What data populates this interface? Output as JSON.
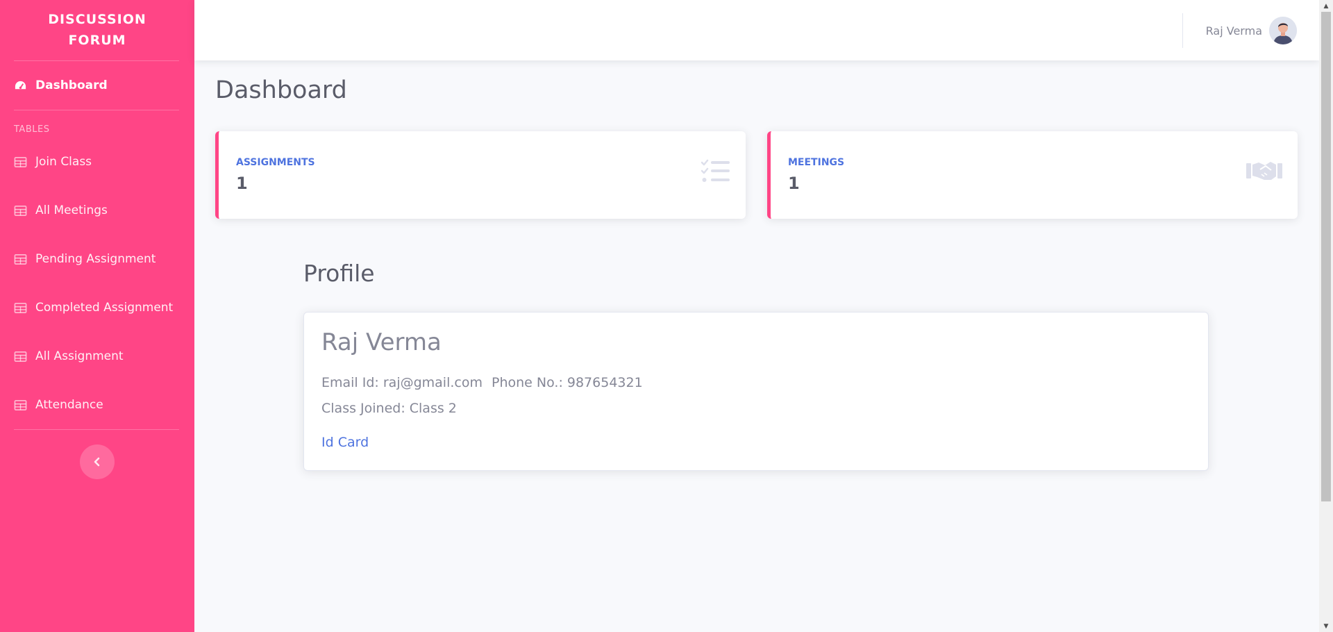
{
  "sidebar": {
    "brand": "DISCUSSION FORUM",
    "dashboard_label": "Dashboard",
    "section_heading": "TABLES",
    "items": [
      {
        "label": "Join Class"
      },
      {
        "label": "All Meetings"
      },
      {
        "label": "Pending Assignment"
      },
      {
        "label": "Completed Assignment"
      },
      {
        "label": "All Assignment"
      },
      {
        "label": "Attendance"
      }
    ],
    "toggle_icon": "chevron-left-icon"
  },
  "topbar": {
    "user_name": "Raj Verma",
    "avatar_icon": "user-avatar-icon"
  },
  "main": {
    "page_title": "Dashboard",
    "cards": [
      {
        "label": "ASSIGNMENTS",
        "value": "1",
        "icon": "tasks-list-icon"
      },
      {
        "label": "MEETINGS",
        "value": "1",
        "icon": "handshake-icon"
      }
    ],
    "profile": {
      "heading": "Profile",
      "name": "Raj Verma",
      "email": "Email Id: raj@gmail.com",
      "phone": "Phone No.: 987654321",
      "class_joined": "Class Joined: Class 2",
      "id_card_link": "Id Card"
    }
  },
  "colors": {
    "sidebar_bg": "#ff4586",
    "accent_blue": "#4e73df",
    "page_bg": "#f8f9fc",
    "text_gray": "#858796"
  }
}
